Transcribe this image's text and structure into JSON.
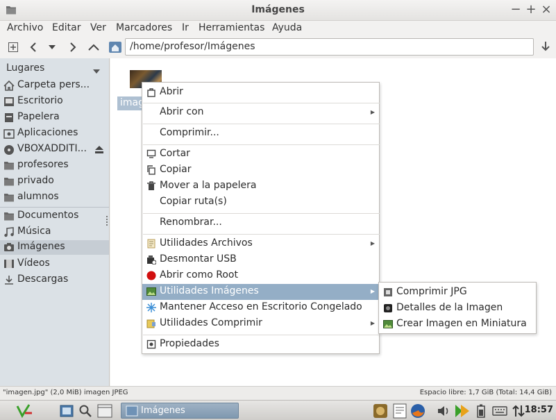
{
  "window": {
    "title": "Imágenes",
    "controls": [
      "minimize-icon",
      "maximize-icon",
      "close-icon"
    ]
  },
  "menubar": {
    "items": [
      {
        "label": "Archivo"
      },
      {
        "label": "Editar"
      },
      {
        "label": "Ver"
      },
      {
        "label": "Marcadores"
      },
      {
        "label": "Ir"
      },
      {
        "label": "Herramientas"
      },
      {
        "label": "Ayuda"
      }
    ]
  },
  "toolbar": {
    "buttons": [
      "new-tab-icon",
      "back-icon",
      "history-dropdown-icon",
      "forward-icon",
      "up-icon",
      "home-folder-icon"
    ],
    "location": "/home/profesor/Imágenes"
  },
  "sidebar": {
    "header": "Lugares",
    "places": [
      {
        "label": "Carpeta pers...",
        "icon": "home-icon"
      },
      {
        "label": "Escritorio",
        "icon": "desktop-icon"
      },
      {
        "label": "Papelera",
        "icon": "trash-icon"
      },
      {
        "label": "Aplicaciones",
        "icon": "applications-icon"
      },
      {
        "label": "VBOXADDITI...",
        "icon": "disc-icon"
      },
      {
        "label": "profesores",
        "icon": "folder-icon"
      },
      {
        "label": "privado",
        "icon": "folder-icon"
      },
      {
        "label": "alumnos",
        "icon": "folder-icon"
      }
    ],
    "bookmarks": [
      {
        "label": "Documentos",
        "icon": "documents-icon"
      },
      {
        "label": "Música",
        "icon": "music-icon"
      },
      {
        "label": "Imágenes",
        "icon": "camera-icon",
        "selected": true
      },
      {
        "label": "Vídeos",
        "icon": "video-icon"
      },
      {
        "label": "Descargas",
        "icon": "download-icon"
      }
    ]
  },
  "content": {
    "file_label_visible": "imag"
  },
  "context_menu": {
    "items": [
      {
        "label": "Abrir",
        "icon": "open-icon"
      },
      {
        "label": "Abrir con",
        "submenu": true
      },
      {
        "label": "Comprimir..."
      },
      {
        "label": "Cortar",
        "icon": "cut-icon"
      },
      {
        "label": "Copiar",
        "icon": "copy-icon"
      },
      {
        "label": "Mover a la papelera",
        "icon": "trash-icon"
      },
      {
        "label": "Copiar ruta(s)"
      },
      {
        "label": "Renombrar..."
      },
      {
        "label": "Utilidades Archivos",
        "icon": "file-utils-icon",
        "submenu": true
      },
      {
        "label": "Desmontar USB",
        "icon": "usb-unmount-icon"
      },
      {
        "label": "Abrir como Root",
        "icon": "root-icon"
      },
      {
        "label": "Utilidades Imágenes",
        "icon": "image-utils-icon",
        "submenu": true,
        "hover": true
      },
      {
        "label": "Mantener Acceso en Escritorio Congelado",
        "icon": "snowflake-icon"
      },
      {
        "label": "Utilidades Comprimir",
        "icon": "compress-utils-icon",
        "submenu": true
      },
      {
        "label": "Propiedades",
        "icon": "properties-icon"
      }
    ]
  },
  "submenu": {
    "items": [
      {
        "label": "Comprimir JPG",
        "icon": "compress-jpg-icon"
      },
      {
        "label": "Detalles de la Imagen",
        "icon": "image-details-icon"
      },
      {
        "label": "Crear Imagen en Miniatura",
        "icon": "thumbnail-icon"
      }
    ]
  },
  "statusbar": {
    "left": "\"imagen.jpg\" (2,0 MiB) imagen JPEG",
    "right": "Espacio libre: 1,7 GiB (Total: 14,4 GiB)"
  },
  "taskbar": {
    "task_label": "Imágenes",
    "clock": "18:57"
  },
  "colors": {
    "sidebar_bg": "#dbe1e6",
    "selection": "#94aec6",
    "task_button": "#8fa5bb"
  }
}
